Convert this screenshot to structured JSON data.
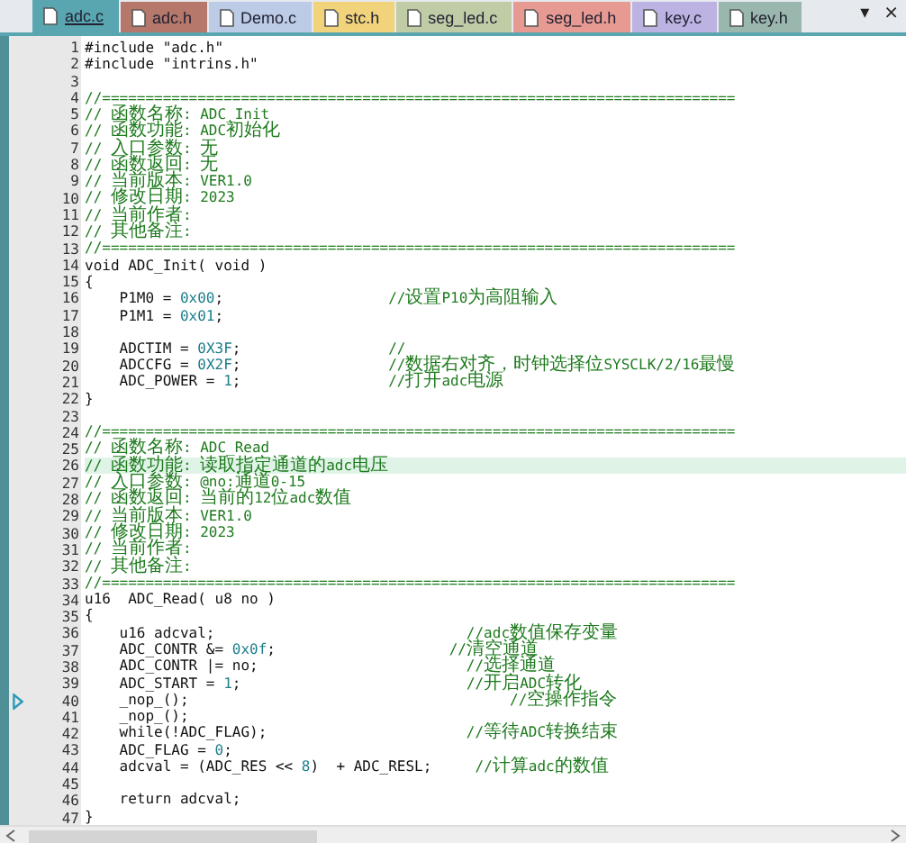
{
  "tabs": [
    {
      "label": "adc.c",
      "color": "#5aa6b0",
      "selected": true
    },
    {
      "label": "adc.h",
      "color": "#b5786a",
      "selected": false
    },
    {
      "label": "Demo.c",
      "color": "#bccbe6",
      "selected": false
    },
    {
      "label": "stc.h",
      "color": "#f0d37a",
      "selected": false
    },
    {
      "label": "seg_led.c",
      "color": "#bfcca6",
      "selected": false
    },
    {
      "label": "seg_led.h",
      "color": "#e79a92",
      "selected": false
    },
    {
      "label": "key.c",
      "color": "#bcb3e2",
      "selected": false
    },
    {
      "label": "key.h",
      "color": "#9ab7ae",
      "selected": false
    }
  ],
  "tab_menu": "▾",
  "tab_close": "×",
  "lines": [
    {
      "num": "1",
      "current": false,
      "marker": false,
      "segments": [
        {
          "kind": "code",
          "text": "#include \"adc.h\""
        }
      ]
    },
    {
      "num": "2",
      "current": false,
      "marker": false,
      "segments": [
        {
          "kind": "code",
          "text": "#include \"intrins.h\""
        }
      ]
    },
    {
      "num": "3",
      "current": false,
      "marker": false
    },
    {
      "num": "4",
      "current": false,
      "marker": false,
      "segments": [
        {
          "kind": "comment",
          "text": "//========================================================================="
        }
      ]
    },
    {
      "num": "5",
      "current": false,
      "marker": false,
      "segments": [
        {
          "kind": "comment",
          "text": "// 函数名称: ADC_Init"
        }
      ]
    },
    {
      "num": "6",
      "current": false,
      "marker": false,
      "segments": [
        {
          "kind": "comment",
          "text": "// 函数功能: ADC初始化"
        }
      ]
    },
    {
      "num": "7",
      "current": false,
      "marker": false,
      "segments": [
        {
          "kind": "comment",
          "text": "// 入口参数: 无"
        }
      ]
    },
    {
      "num": "8",
      "current": false,
      "marker": false,
      "segments": [
        {
          "kind": "comment",
          "text": "// 函数返回: 无"
        }
      ]
    },
    {
      "num": "9",
      "current": false,
      "marker": false,
      "segments": [
        {
          "kind": "comment",
          "text": "// 当前版本: VER1.0"
        }
      ]
    },
    {
      "num": "10",
      "current": false,
      "marker": false,
      "segments": [
        {
          "kind": "comment",
          "text": "// 修改日期: 2023"
        }
      ]
    },
    {
      "num": "11",
      "current": false,
      "marker": false,
      "segments": [
        {
          "kind": "comment",
          "text": "// 当前作者:"
        }
      ]
    },
    {
      "num": "12",
      "current": false,
      "marker": false,
      "segments": [
        {
          "kind": "comment",
          "text": "// 其他备注:"
        }
      ]
    },
    {
      "num": "13",
      "current": false,
      "marker": false,
      "segments": [
        {
          "kind": "comment",
          "text": "//========================================================================="
        }
      ]
    },
    {
      "num": "14",
      "current": false,
      "marker": false,
      "segments": [
        {
          "kind": "code",
          "text": "void ADC_Init( void )"
        }
      ]
    },
    {
      "num": "15",
      "current": false,
      "marker": false,
      "segments": [
        {
          "kind": "code",
          "text": "{"
        }
      ]
    },
    {
      "num": "16",
      "current": false,
      "marker": false,
      "segments": [
        {
          "kind": "code",
          "text": "    P1M0 = "
        },
        {
          "kind": "number",
          "text": "0x00"
        },
        {
          "kind": "code",
          "text": ";                   "
        },
        {
          "kind": "comment",
          "text": "//设置P10为高阻输入"
        }
      ]
    },
    {
      "num": "17",
      "current": false,
      "marker": false,
      "segments": [
        {
          "kind": "code",
          "text": "    P1M1 = "
        },
        {
          "kind": "number",
          "text": "0x01"
        },
        {
          "kind": "code",
          "text": ";"
        }
      ]
    },
    {
      "num": "18",
      "current": false,
      "marker": false
    },
    {
      "num": "19",
      "current": false,
      "marker": false,
      "segments": [
        {
          "kind": "code",
          "text": "    ADCTIM = "
        },
        {
          "kind": "number",
          "text": "0X3F"
        },
        {
          "kind": "code",
          "text": ";                 "
        },
        {
          "kind": "comment",
          "text": "//"
        }
      ]
    },
    {
      "num": "20",
      "current": false,
      "marker": false,
      "segments": [
        {
          "kind": "code",
          "text": "    ADCCFG = "
        },
        {
          "kind": "number",
          "text": "0X2F"
        },
        {
          "kind": "code",
          "text": ";                 "
        },
        {
          "kind": "comment",
          "text": "//数据右对齐，时钟选择位SYSCLK/2/16最慢"
        }
      ]
    },
    {
      "num": "21",
      "current": false,
      "marker": false,
      "segments": [
        {
          "kind": "code",
          "text": "    ADC_POWER = "
        },
        {
          "kind": "number",
          "text": "1"
        },
        {
          "kind": "code",
          "text": ";                 "
        },
        {
          "kind": "comment",
          "text": "//打开adc电源"
        }
      ]
    },
    {
      "num": "22",
      "current": false,
      "marker": false,
      "segments": [
        {
          "kind": "code",
          "text": "}"
        }
      ]
    },
    {
      "num": "23",
      "current": false,
      "marker": false
    },
    {
      "num": "24",
      "current": false,
      "marker": false,
      "segments": [
        {
          "kind": "comment",
          "text": "//========================================================================="
        }
      ]
    },
    {
      "num": "25",
      "current": false,
      "marker": false,
      "segments": [
        {
          "kind": "comment",
          "text": "// 函数名称: ADC_Read"
        }
      ]
    },
    {
      "num": "26",
      "current": true,
      "marker": false,
      "segments": [
        {
          "kind": "comment",
          "text": "// 函数功能: 读取指定通道的adc电压"
        }
      ]
    },
    {
      "num": "27",
      "current": false,
      "marker": false,
      "segments": [
        {
          "kind": "comment",
          "text": "// 入口参数: @no:通道0-15"
        }
      ]
    },
    {
      "num": "28",
      "current": false,
      "marker": false,
      "segments": [
        {
          "kind": "comment",
          "text": "// 函数返回: 当前的12位adc数值"
        }
      ]
    },
    {
      "num": "29",
      "current": false,
      "marker": false,
      "segments": [
        {
          "kind": "comment",
          "text": "// 当前版本: VER1.0"
        }
      ]
    },
    {
      "num": "30",
      "current": false,
      "marker": false,
      "segments": [
        {
          "kind": "comment",
          "text": "// 修改日期: 2023"
        }
      ]
    },
    {
      "num": "31",
      "current": false,
      "marker": false,
      "segments": [
        {
          "kind": "comment",
          "text": "// 当前作者:"
        }
      ]
    },
    {
      "num": "32",
      "current": false,
      "marker": false,
      "segments": [
        {
          "kind": "comment",
          "text": "// 其他备注:"
        }
      ]
    },
    {
      "num": "33",
      "current": false,
      "marker": false,
      "segments": [
        {
          "kind": "comment",
          "text": "//========================================================================="
        }
      ]
    },
    {
      "num": "34",
      "current": false,
      "marker": false,
      "segments": [
        {
          "kind": "code",
          "text": "u16  ADC_Read( u8 no )"
        }
      ]
    },
    {
      "num": "35",
      "current": false,
      "marker": false,
      "segments": [
        {
          "kind": "code",
          "text": "{"
        }
      ]
    },
    {
      "num": "36",
      "current": false,
      "marker": false,
      "segments": [
        {
          "kind": "code",
          "text": "    u16 adcval;                             "
        },
        {
          "kind": "comment",
          "text": "//adc数值保存变量"
        }
      ]
    },
    {
      "num": "37",
      "current": false,
      "marker": false,
      "segments": [
        {
          "kind": "code",
          "text": "    ADC_CONTR &= "
        },
        {
          "kind": "number",
          "text": "0x0f"
        },
        {
          "kind": "code",
          "text": ";                    "
        },
        {
          "kind": "comment",
          "text": "//清空通道"
        }
      ]
    },
    {
      "num": "38",
      "current": false,
      "marker": false,
      "segments": [
        {
          "kind": "code",
          "text": "    ADC_CONTR |= no;                        "
        },
        {
          "kind": "comment",
          "text": "//选择通道"
        }
      ]
    },
    {
      "num": "39",
      "current": false,
      "marker": false,
      "segments": [
        {
          "kind": "code",
          "text": "    ADC_START = "
        },
        {
          "kind": "number",
          "text": "1"
        },
        {
          "kind": "code",
          "text": ";                          "
        },
        {
          "kind": "comment",
          "text": "//开启ADC转化"
        }
      ]
    },
    {
      "num": "40",
      "current": false,
      "marker": true,
      "segments": [
        {
          "kind": "code",
          "text": "    _nop_();                                     "
        },
        {
          "kind": "comment",
          "text": "//空操作指令"
        }
      ]
    },
    {
      "num": "41",
      "current": false,
      "marker": false,
      "segments": [
        {
          "kind": "code",
          "text": "    _nop_();"
        }
      ]
    },
    {
      "num": "42",
      "current": false,
      "marker": false,
      "segments": [
        {
          "kind": "code",
          "text": "    while(!ADC_FLAG);                       "
        },
        {
          "kind": "comment",
          "text": "//等待ADC转换结束"
        }
      ]
    },
    {
      "num": "43",
      "current": false,
      "marker": false,
      "segments": [
        {
          "kind": "code",
          "text": "    ADC_FLAG = "
        },
        {
          "kind": "number",
          "text": "0"
        },
        {
          "kind": "code",
          "text": ";"
        }
      ]
    },
    {
      "num": "44",
      "current": false,
      "marker": false,
      "segments": [
        {
          "kind": "code",
          "text": "    adcval = (ADC_RES << "
        },
        {
          "kind": "number",
          "text": "8"
        },
        {
          "kind": "code",
          "text": ")  + ADC_RESL;     "
        },
        {
          "kind": "comment",
          "text": "//计算adc的数值"
        }
      ]
    },
    {
      "num": "45",
      "current": false,
      "marker": false
    },
    {
      "num": "46",
      "current": false,
      "marker": false,
      "segments": [
        {
          "kind": "code",
          "text": "    return adcval;"
        }
      ]
    },
    {
      "num": "47",
      "current": false,
      "marker": false,
      "segments": [
        {
          "kind": "code",
          "text": "}"
        }
      ]
    }
  ]
}
